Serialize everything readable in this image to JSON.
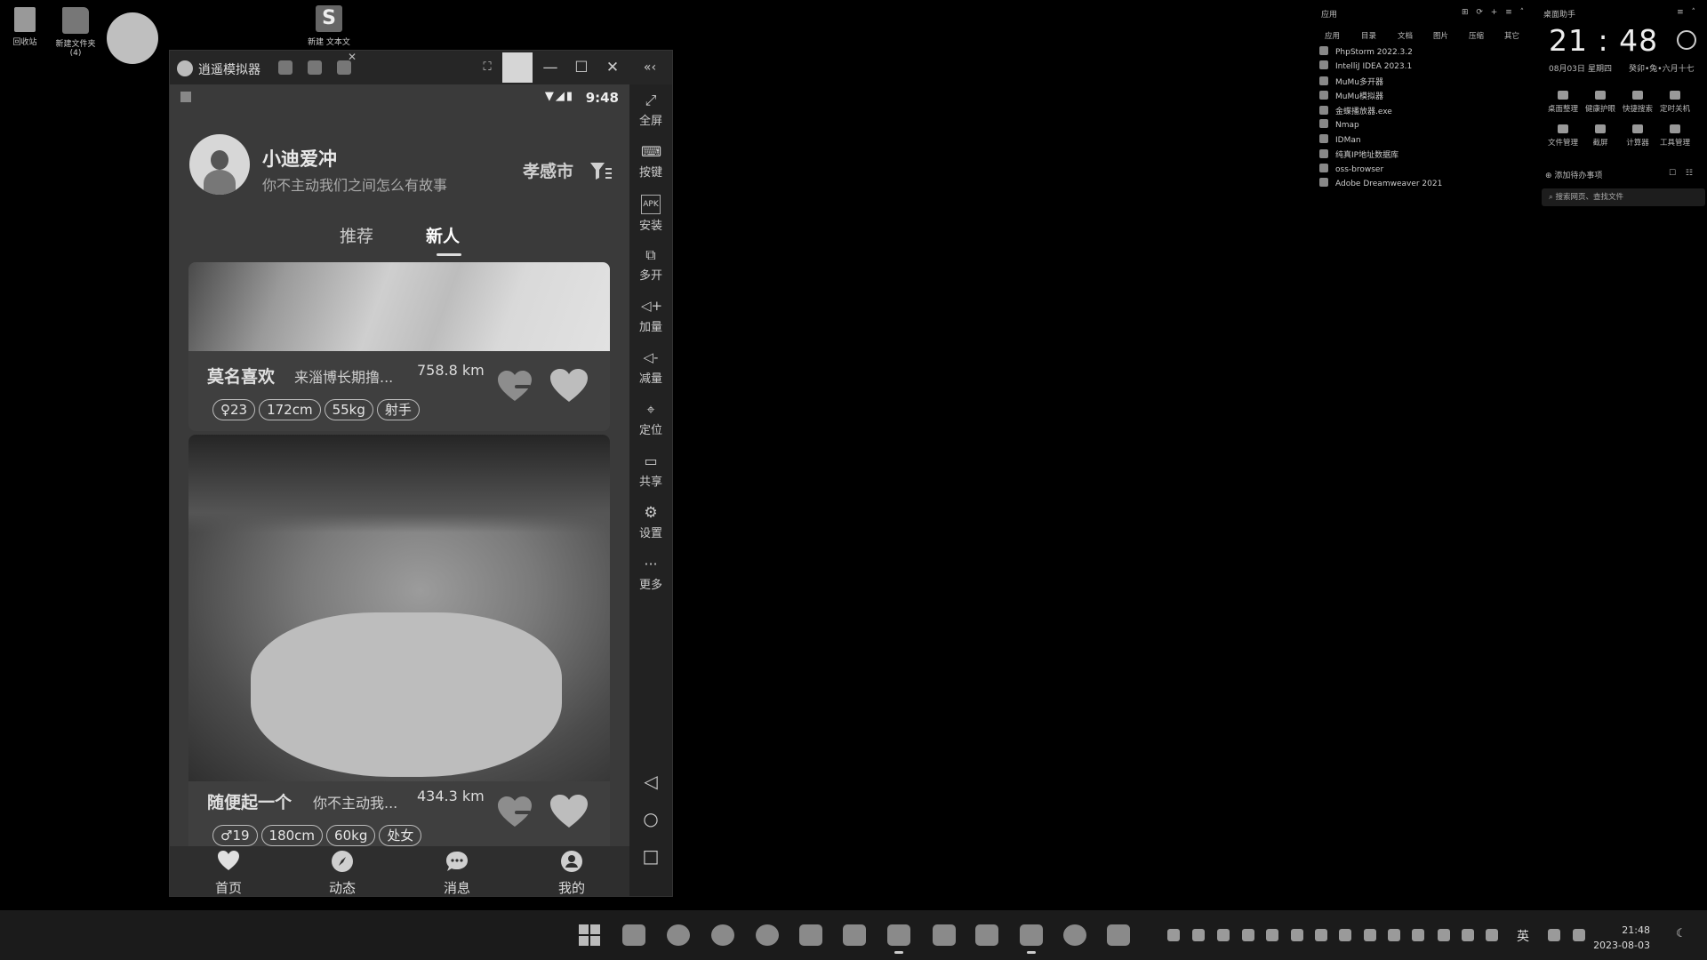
{
  "desktop": {
    "icons": [
      {
        "label": "回收站",
        "icon": "recycle-bin-icon"
      },
      {
        "label": "新建文件夹\n(4)",
        "icon": "folder-icon"
      },
      {
        "label": "新建 文本文",
        "icon": "text-file-icon"
      }
    ]
  },
  "emulator": {
    "title": "逍遥模拟器",
    "status_bar": {
      "time": "9:48"
    },
    "sidebar": [
      {
        "label": "全屏",
        "icon": "fullscreen-icon"
      },
      {
        "label": "按键",
        "icon": "keyboard-icon"
      },
      {
        "label": "安装",
        "icon": "apk-install-icon"
      },
      {
        "label": "多开",
        "icon": "multi-instance-icon"
      },
      {
        "label": "加量",
        "icon": "volume-up-icon"
      },
      {
        "label": "减量",
        "icon": "volume-down-icon"
      },
      {
        "label": "定位",
        "icon": "location-icon"
      },
      {
        "label": "共享",
        "icon": "shared-folder-icon"
      },
      {
        "label": "设置",
        "icon": "settings-gear-icon"
      },
      {
        "label": "更多",
        "icon": "more-dots-icon"
      }
    ]
  },
  "app": {
    "user": {
      "name": "小迪爱冲",
      "signature": "你不主动我们之间怎么有故事"
    },
    "city": "孝感市",
    "tabs": [
      {
        "label": "推荐",
        "active": false
      },
      {
        "label": "新人",
        "active": true
      }
    ],
    "cards": [
      {
        "name": "莫名喜欢",
        "desc": "来淄博长期撸...",
        "distance": "758.8 km",
        "tags": [
          "♀23",
          "172cm",
          "55kg",
          "射手"
        ]
      },
      {
        "name": "随便起一个",
        "desc": "你不主动我...",
        "distance": "434.3 km",
        "tags": [
          "♂19",
          "180cm",
          "60kg",
          "处女"
        ]
      }
    ],
    "bottom_nav": [
      {
        "label": "首页",
        "icon": "home-heart-icon"
      },
      {
        "label": "动态",
        "icon": "compass-icon"
      },
      {
        "label": "消息",
        "icon": "message-bubble-icon"
      },
      {
        "label": "我的",
        "icon": "profile-icon"
      }
    ]
  },
  "apps_panel": {
    "title": "应用",
    "categories": [
      "应用",
      "目录",
      "文档",
      "图片",
      "压缩",
      "其它"
    ],
    "items": [
      "PhpStorm 2022.3.2",
      "IntelliJ IDEA 2023.1",
      "MuMu多开器",
      "MuMu模拟器",
      "金蝶播放器.exe",
      "Nmap",
      "IDMan",
      "纯真IP地址数据库",
      "oss-browser",
      "Adobe Dreamweaver 2021"
    ]
  },
  "assistant": {
    "title": "桌面助手",
    "time": "21 : 48",
    "date": "08月03日",
    "weekday": "星期四",
    "lunar": "癸卯•兔•六月十七",
    "quick_actions": [
      "桌面整理",
      "健康护眼",
      "快捷搜索",
      "定时关机",
      "文件管理",
      "截屏",
      "计算器",
      "工具管理"
    ],
    "todo": "添加待办事项",
    "search_placeholder": "搜索网页、查找文件"
  },
  "taskbar": {
    "ime": "英",
    "time": "21:48",
    "date": "2023-08-03"
  }
}
